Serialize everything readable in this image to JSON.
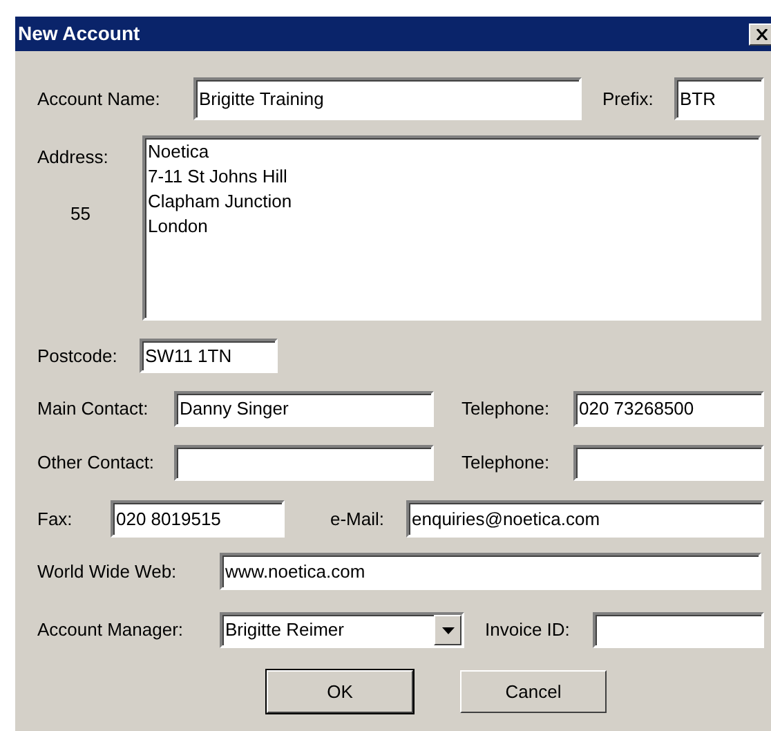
{
  "window": {
    "title": "New Account"
  },
  "account_name": {
    "label": "Account Name:",
    "value": "Brigitte Training"
  },
  "prefix": {
    "label": "Prefix:",
    "value": "BTR"
  },
  "address": {
    "label": "Address:",
    "count": "55",
    "lines": [
      "Noetica",
      "7-11 St Johns Hill",
      "Clapham Junction",
      "London"
    ]
  },
  "postcode": {
    "label": "Postcode:",
    "value": "SW11 1TN"
  },
  "main_contact": {
    "label": "Main Contact:",
    "value": "Danny Singer"
  },
  "main_telephone": {
    "label": "Telephone:",
    "value": "020 73268500"
  },
  "other_contact": {
    "label": "Other Contact:"
  },
  "other_telephone": {
    "label": "Telephone:"
  },
  "fax": {
    "label": "Fax:",
    "value": "020 8019515"
  },
  "email": {
    "label": "e-Mail:",
    "value": "enquiries@noetica.com"
  },
  "web": {
    "label": "World Wide Web:",
    "value": "www.noetica.com"
  },
  "account_manager": {
    "label": "Account Manager:",
    "value": "Brigitte Reimer"
  },
  "invoice_id": {
    "label": "Invoice ID:"
  },
  "buttons": [
    {
      "label": "OK",
      "default": true
    },
    {
      "label": "Cancel",
      "default": false
    }
  ]
}
